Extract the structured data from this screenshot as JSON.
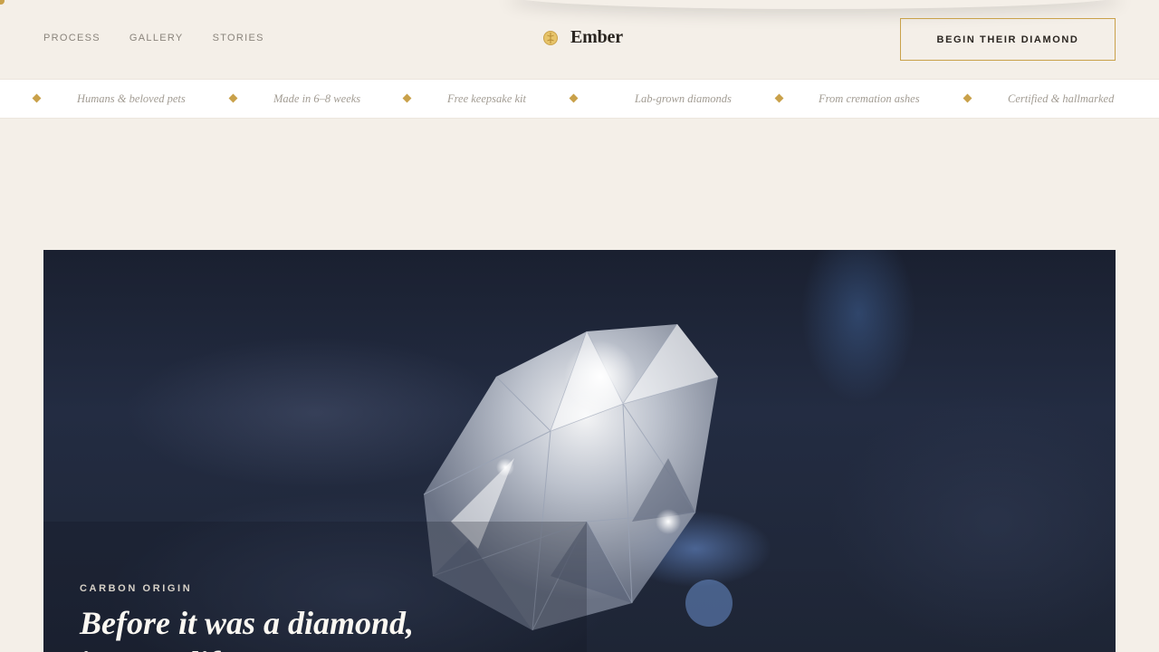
{
  "nav": {
    "links": [
      "PROCESS",
      "GALLERY",
      "STORIES"
    ]
  },
  "brand": {
    "name": "Ember",
    "icon": "seed-icon"
  },
  "cta": {
    "label": "BEGIN THEIR DIAMOND"
  },
  "ticker": {
    "items": [
      "Humans & beloved pets",
      "Made in 6–8 weeks",
      "Free keepsake kit",
      "Lab-grown diamonds",
      "From cremation ashes",
      "Certified & hallmarked"
    ]
  },
  "hero": {
    "eyebrow": "CARBON ORIGIN",
    "title_line1": "Before it was a diamond,",
    "title_line2": "it was a life."
  },
  "colors": {
    "background": "#f4efe8",
    "accent": "#c9a14a",
    "text": "#2a2520",
    "muted": "#8a847c"
  }
}
